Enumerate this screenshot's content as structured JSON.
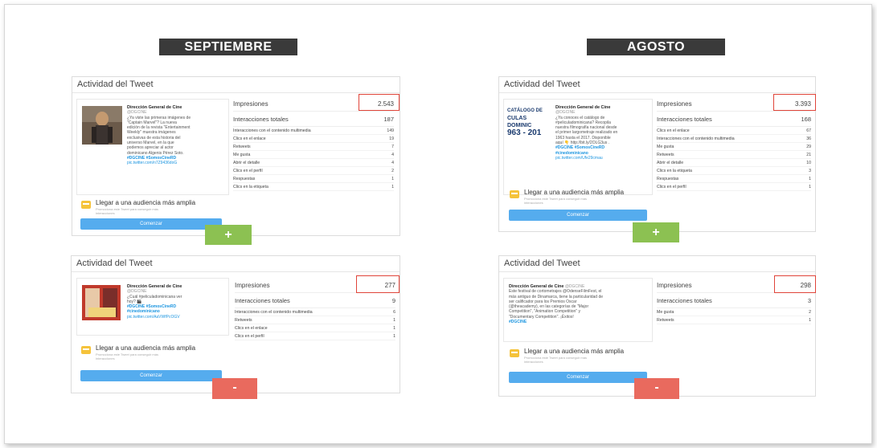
{
  "banners": {
    "left": "SEPTIEMBRE",
    "right": "AGOSTO"
  },
  "colors": {
    "banner_bg": "#3a3a3a",
    "plus": "#8cc152",
    "minus": "#e96a5e",
    "highlight": "#e0453a",
    "button": "#55acee",
    "hashtag": "#1b95e0"
  },
  "common": {
    "card_title": "Actividad del Tweet",
    "promo_title": "Llegar a una audiencia más amplia",
    "promo_sub_1": "Promociona este Tweet para conseguir más",
    "promo_sub_2": "interacciones",
    "start_button": "Comenzar",
    "plus": "+",
    "minus": "-",
    "author": "Dirección General de Cine",
    "handle": "@DGCINE"
  },
  "cards": {
    "sep_top": {
      "tweet_lines": [
        "¿Ya viste las primeras imágenes de",
        "\"Captain Marvel\"? La nueva",
        "edición de la revista \"Entertainment",
        "Weekly\" muestra imágenes",
        "exclusivas de esta historia del",
        "universo Marvel, en la que",
        "podemos apreciar al actor",
        "dominicano Algenis Pérez Soto."
      ],
      "tags": "#DGCINE #SomosCineRD",
      "link": "pic.twitter.com/n7Z9436doG",
      "impressions_label": "Impresiones",
      "impressions": "2.543",
      "interactions_label": "Interacciones totales",
      "interactions": "187",
      "rows": [
        {
          "label": "Interacciones con el contenido multimedia",
          "value": "149"
        },
        {
          "label": "Clics en el enlace",
          "value": "19"
        },
        {
          "label": "Retweets",
          "value": "7"
        },
        {
          "label": "Me gusta",
          "value": "4"
        },
        {
          "label": "Abrir el detalle",
          "value": "4"
        },
        {
          "label": "Clics en el perfil",
          "value": "2"
        },
        {
          "label": "Respuestas",
          "value": "1"
        },
        {
          "label": "Clics en la etiqueta",
          "value": "1"
        }
      ]
    },
    "ago_top": {
      "thumb_line_1": "CATÁLOGO DE",
      "thumb_line_2": "CULAS DOMINIC",
      "thumb_line_3": "963 - 201",
      "tweet_lines": [
        "¿Ya conoces el catálogo de",
        "#peliculadominicana? Recopila",
        "nuestra filmografía nacional desde",
        "el primer largometraje realizado en",
        "1963 hasta el 2017. Disponible",
        "aquí 👇 http://bit.ly/2OLG3us ."
      ],
      "tags_lines": [
        "#DGCINE #SomosCineRD",
        "#cinedominicano"
      ],
      "link": "pic.twitter.com/Ufe29cmau",
      "impressions_label": "Impresiones",
      "impressions": "3.393",
      "interactions_label": "Interacciones totales",
      "interactions": "168",
      "rows": [
        {
          "label": "Clics en el enlace",
          "value": "67"
        },
        {
          "label": "Interacciones con el contenido multimedia",
          "value": "36"
        },
        {
          "label": "Me gusta",
          "value": "29"
        },
        {
          "label": "Retweets",
          "value": "21"
        },
        {
          "label": "Abrir el detalle",
          "value": "10"
        },
        {
          "label": "Clics en la etiqueta",
          "value": "3"
        },
        {
          "label": "Respuestas",
          "value": "1"
        },
        {
          "label": "Clics en el perfil",
          "value": "1"
        }
      ]
    },
    "sep_bottom": {
      "tweet_lines": [
        "¿Cuál #peliculadominicana ver",
        "hoy? 🎬"
      ],
      "tags_lines": [
        "#DGCINE #SomosCineRD",
        "#cinedominicano"
      ],
      "link": "pic.twitter.com/AaVWfPcOGV",
      "impressions_label": "Impresiones",
      "impressions": "277",
      "interactions_label": "Interacciones totales",
      "interactions": "9",
      "rows": [
        {
          "label": "Interacciones con el contenido multimedia",
          "value": "6"
        },
        {
          "label": "Retweets",
          "value": "1"
        },
        {
          "label": "Clics en el enlace",
          "value": "1"
        },
        {
          "label": "Clics en el perfil",
          "value": "1"
        }
      ]
    },
    "ago_bottom": {
      "tweet_lines": [
        "Este festival de cortometrajes @OdenseFilmFest, el",
        "más antiguo de Dinamarca, tiene la particularidad de",
        "ser calificador para los Premios Oscar",
        "(@theacademy), en las categorías de \"Major",
        "Competition\", \"Animation Competition\" y",
        "\"Documentary Competition\". ¡Éxitos!"
      ],
      "tags": "#DGCINE",
      "impressions_label": "Impresiones",
      "impressions": "298",
      "interactions_label": "Interacciones totales",
      "interactions": "3",
      "rows": [
        {
          "label": "Me gusta",
          "value": "2"
        },
        {
          "label": "Retweets",
          "value": "1"
        }
      ]
    }
  }
}
